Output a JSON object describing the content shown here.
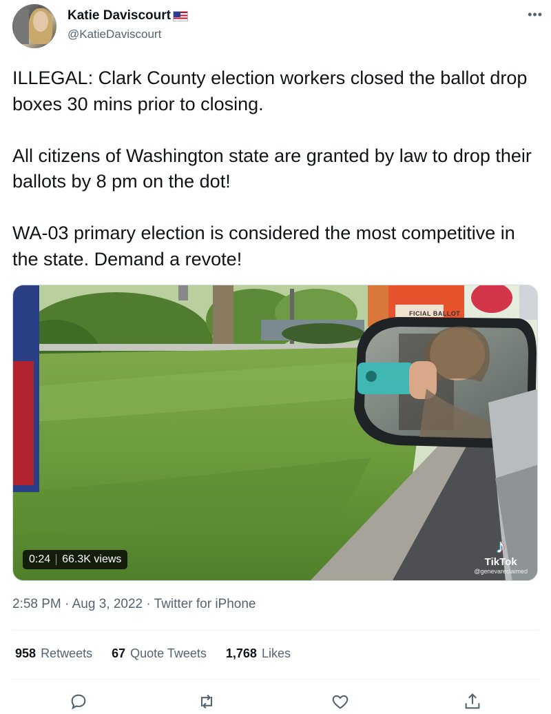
{
  "author": {
    "display_name": "Katie Daviscourt",
    "handle": "@KatieDaviscourt",
    "flag_icon": "us-flag-emoji"
  },
  "tweet": {
    "paragraphs": [
      "ILLEGAL: Clark County election workers closed the ballot drop boxes 30 mins prior to closing.",
      "All citizens of Washington state are granted by law to drop their ballots by 8 pm on the dot!",
      "WA-03 primary election is considered the most competitive in the state. Demand a revote!"
    ]
  },
  "media": {
    "duration": "0:24",
    "views": "66.3K views",
    "watermark_brand": "TikTok",
    "watermark_user": "@genevareclaimed",
    "sign_text": "FICIAL BALLOT"
  },
  "meta": {
    "time": "2:58 PM",
    "date": "Aug 3, 2022",
    "source": "Twitter for iPhone",
    "separator": "·"
  },
  "stats": {
    "retweets_count": "958",
    "retweets_label": "Retweets",
    "quotes_count": "67",
    "quotes_label": "Quote Tweets",
    "likes_count": "1,768",
    "likes_label": "Likes"
  },
  "actions": [
    "reply-icon",
    "retweet-icon",
    "like-icon",
    "share-icon"
  ],
  "colors": {
    "text_primary": "#0f1419",
    "text_secondary": "#536471",
    "divider": "#eff3f4"
  }
}
